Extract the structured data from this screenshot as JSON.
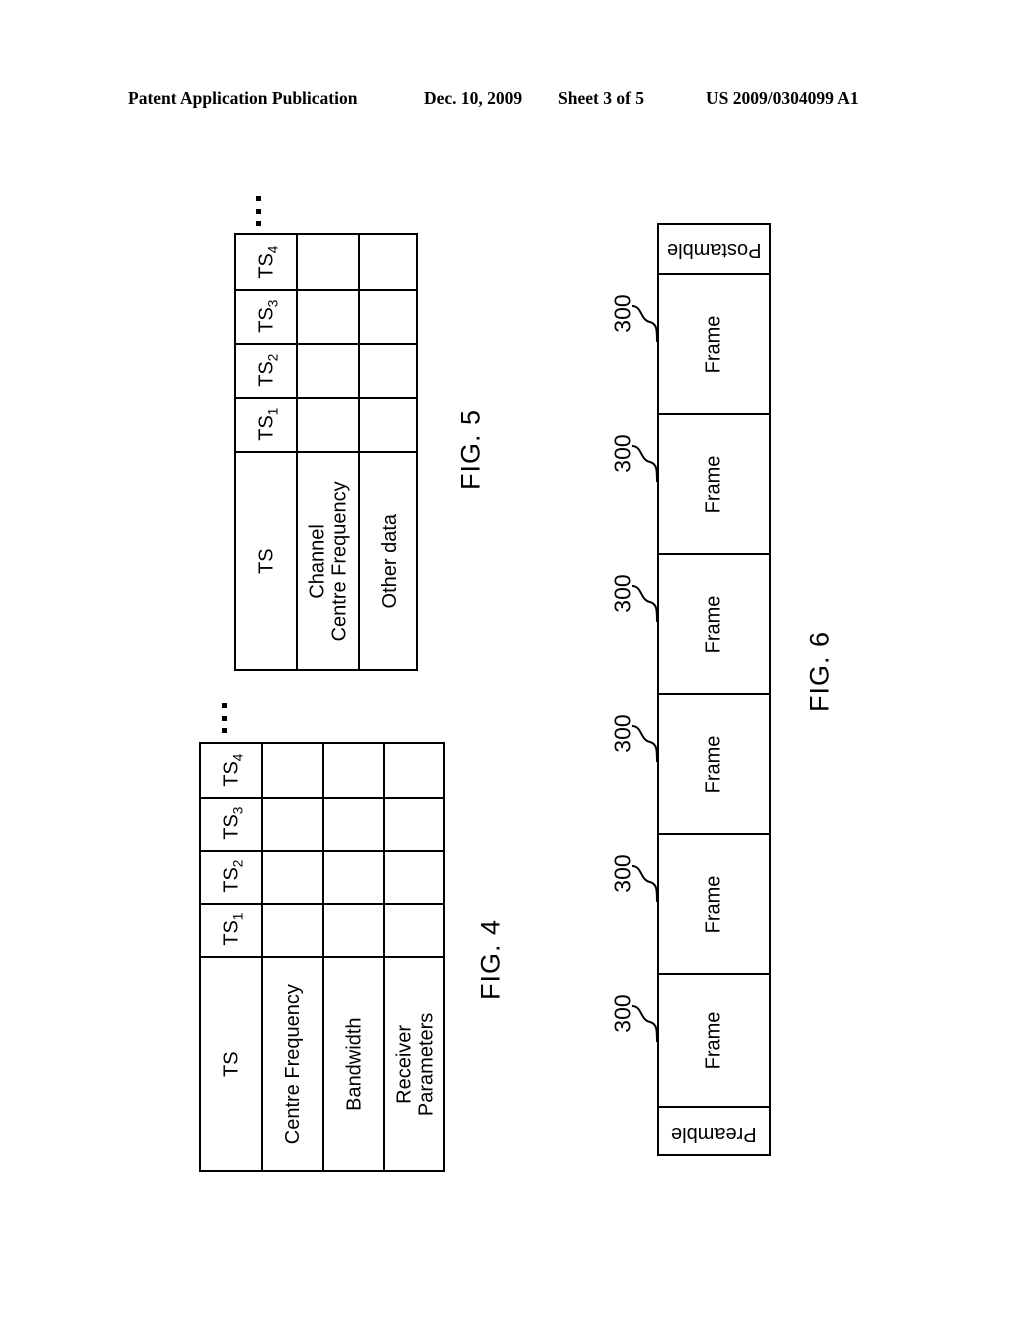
{
  "header": {
    "publication": "Patent Application Publication",
    "date": "Dec. 10, 2009",
    "sheet": "Sheet 3 of 5",
    "number": "US 2009/0304099 A1"
  },
  "figures": {
    "fig5": {
      "caption": "FIG. 5",
      "ellipsis": "...",
      "row_labels": [
        "TS",
        "Channel Centre Frequency",
        "Other data"
      ],
      "rows": [
        {
          "label_line1": "TS",
          "label_line2": ""
        },
        {
          "label_line1": "Channel",
          "label_line2": "Centre Frequency"
        },
        {
          "label_line1": "Other data",
          "label_line2": ""
        }
      ],
      "columns": [
        {
          "label": "TS",
          "sub": "1"
        },
        {
          "label": "TS",
          "sub": "2"
        },
        {
          "label": "TS",
          "sub": "3"
        },
        {
          "label": "TS",
          "sub": "4"
        }
      ]
    },
    "fig4": {
      "caption": "FIG. 4",
      "ellipsis": "...",
      "row_labels": [
        "TS",
        "Centre Frequency",
        "Bandwidth",
        "Receiver Parameters"
      ],
      "rows": [
        {
          "label_line1": "TS",
          "label_line2": ""
        },
        {
          "label_line1": "Centre Frequency",
          "label_line2": ""
        },
        {
          "label_line1": "Bandwidth",
          "label_line2": ""
        },
        {
          "label_line1": "Receiver",
          "label_line2": "Parameters"
        }
      ],
      "columns": [
        {
          "label": "TS",
          "sub": "1"
        },
        {
          "label": "TS",
          "sub": "2"
        },
        {
          "label": "TS",
          "sub": "3"
        },
        {
          "label": "TS",
          "sub": "4"
        }
      ]
    },
    "fig6": {
      "caption": "FIG. 6",
      "cells": [
        {
          "label": "Postamble",
          "orientation": "inverted",
          "ref": ""
        },
        {
          "label": "Frame",
          "orientation": "normal",
          "ref": "300"
        },
        {
          "label": "Frame",
          "orientation": "normal",
          "ref": "300"
        },
        {
          "label": "Frame",
          "orientation": "normal",
          "ref": "300"
        },
        {
          "label": "Frame",
          "orientation": "normal",
          "ref": "300"
        },
        {
          "label": "Frame",
          "orientation": "normal",
          "ref": "300"
        },
        {
          "label": "Frame",
          "orientation": "normal",
          "ref": "300"
        },
        {
          "label": "Preamble",
          "orientation": "inverted",
          "ref": ""
        }
      ],
      "reference_numeral": "300"
    }
  }
}
